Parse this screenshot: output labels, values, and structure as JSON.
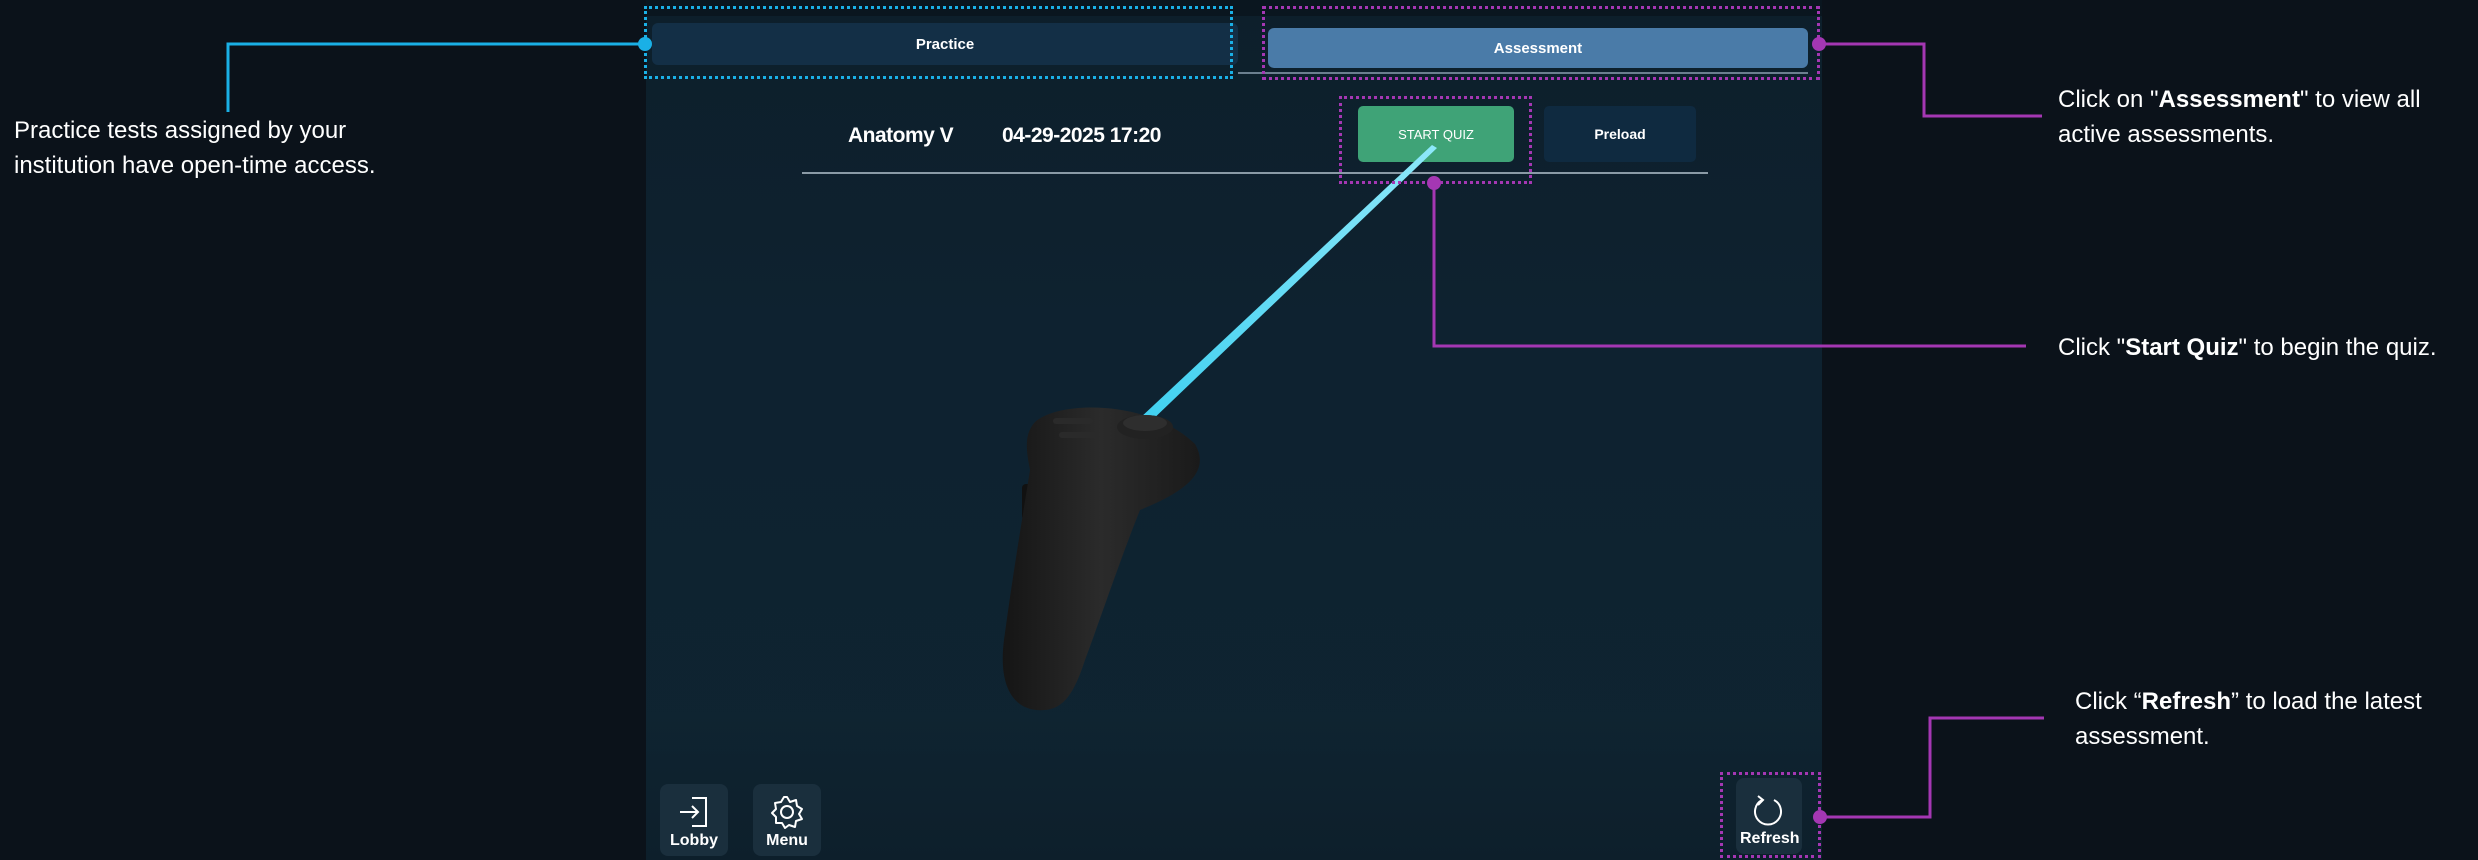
{
  "tabs": {
    "practice_label": "Practice",
    "assessment_label": "Assessment"
  },
  "quiz": {
    "name": "Anatomy V",
    "datetime": "04-29-2025 17:20",
    "start_label": "START QUIZ",
    "preload_label": "Preload"
  },
  "footer": {
    "lobby_label": "Lobby",
    "menu_label": "Menu",
    "refresh_label": "Refresh"
  },
  "annotations": {
    "practice": {
      "line1": "Practice tests assigned by your",
      "line2": "institution have open-time access."
    },
    "assessment": {
      "pre": "Click on \"",
      "bold": "Assessment",
      "post": "\" to view all",
      "line2": "active assessments."
    },
    "start_quiz": {
      "pre": "Click \"",
      "bold": "Start Quiz",
      "post": "\" to begin the quiz."
    },
    "refresh": {
      "pre": "Click “",
      "bold": "Refresh",
      "post": "” to load the latest",
      "line2": "assessment."
    }
  },
  "colors": {
    "annotation_cyan": "#1ab0e6",
    "annotation_purple": "#a437b3",
    "start_button": "#3fa377",
    "assessment_tab": "#4a7ba8",
    "laser": "#3fd0f0"
  },
  "icons": {
    "lobby": "exit-door-icon",
    "menu": "gear-icon",
    "refresh": "refresh-icon",
    "controller": "vr-controller"
  }
}
